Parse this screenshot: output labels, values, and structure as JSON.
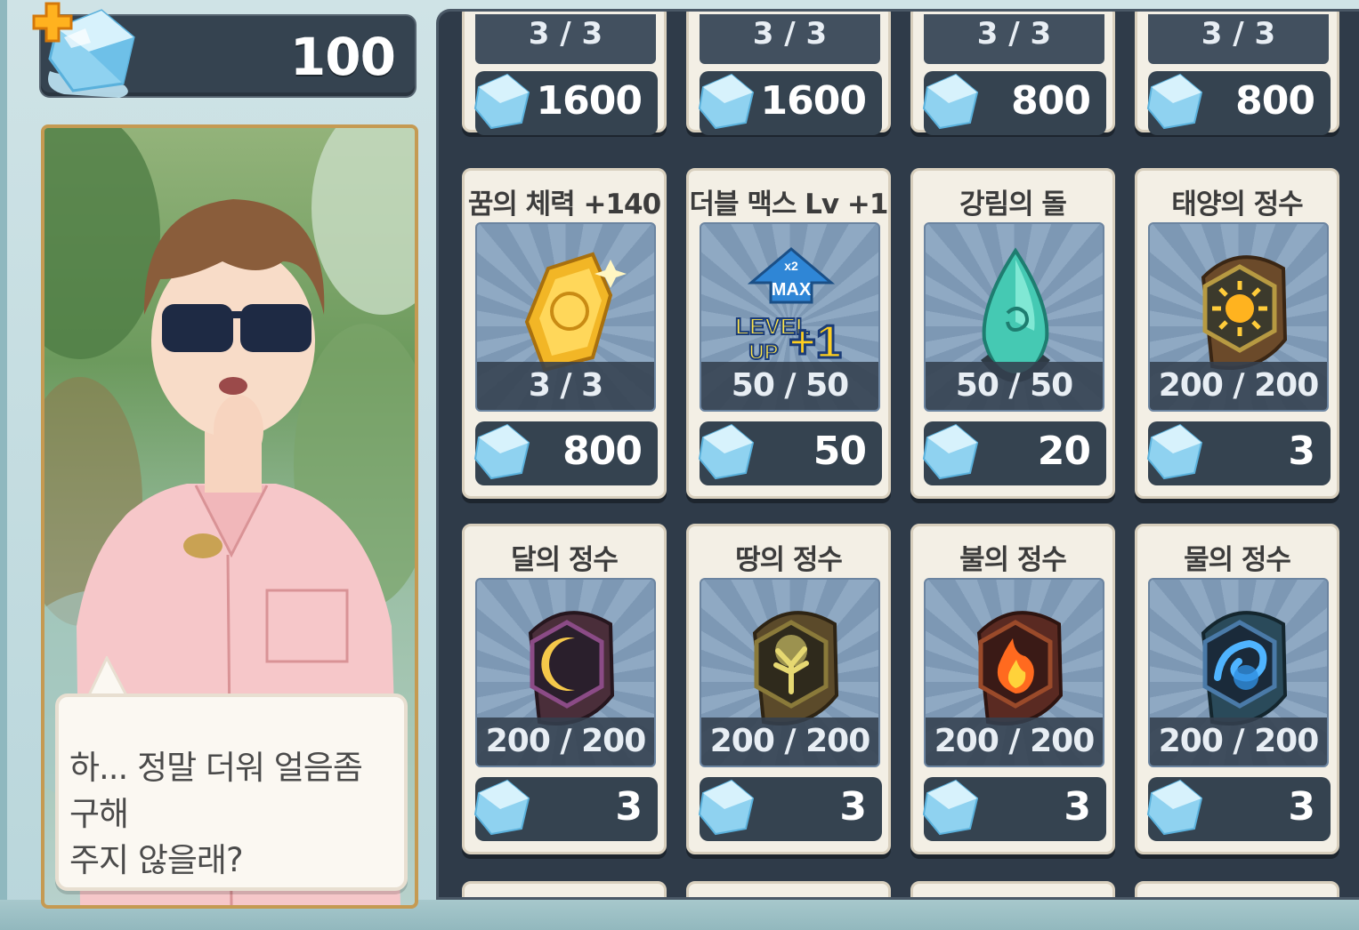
{
  "currency": {
    "value": "100",
    "icon": "ice-cube-icon",
    "add_icon": "plus-icon"
  },
  "character": {
    "speech_line1": "하... 정말 더워 얼음좀 구해",
    "speech_line2": "주지 않을래?"
  },
  "shop": {
    "top_row": [
      {
        "count": "3 / 3",
        "price": "1600"
      },
      {
        "count": "3 / 3",
        "price": "1600"
      },
      {
        "count": "3 / 3",
        "price": "800"
      },
      {
        "count": "3 / 3",
        "price": "800"
      }
    ],
    "items": [
      {
        "title": "꿈의 체력 +140",
        "count": "3 / 3",
        "price": "800",
        "icon": "golden-scale-icon"
      },
      {
        "title": "더블 맥스 Lv +1",
        "count": "50 / 50",
        "price": "50",
        "icon": "level-up-icon",
        "badge_top": "x2",
        "badge_max": "MAX",
        "badge_level": "LEVEL",
        "badge_up": "UP",
        "badge_plus": "+1"
      },
      {
        "title": "강림의 돌",
        "count": "50 / 50",
        "price": "20",
        "icon": "teal-crystal-icon"
      },
      {
        "title": "태양의 정수",
        "count": "200 / 200",
        "price": "3",
        "icon": "sun-essence-icon"
      },
      {
        "title": "달의 정수",
        "count": "200 / 200",
        "price": "3",
        "icon": "moon-essence-icon"
      },
      {
        "title": "땅의 정수",
        "count": "200 / 200",
        "price": "3",
        "icon": "earth-essence-icon"
      },
      {
        "title": "불의 정수",
        "count": "200 / 200",
        "price": "3",
        "icon": "fire-essence-icon"
      },
      {
        "title": "물의 정수",
        "count": "200 / 200",
        "price": "3",
        "icon": "water-essence-icon"
      }
    ]
  },
  "colors": {
    "panel_bg": "#2f3b49",
    "card_bg": "#f3efe5",
    "price_bg": "#354350",
    "frame_gold": "#c59a52"
  }
}
